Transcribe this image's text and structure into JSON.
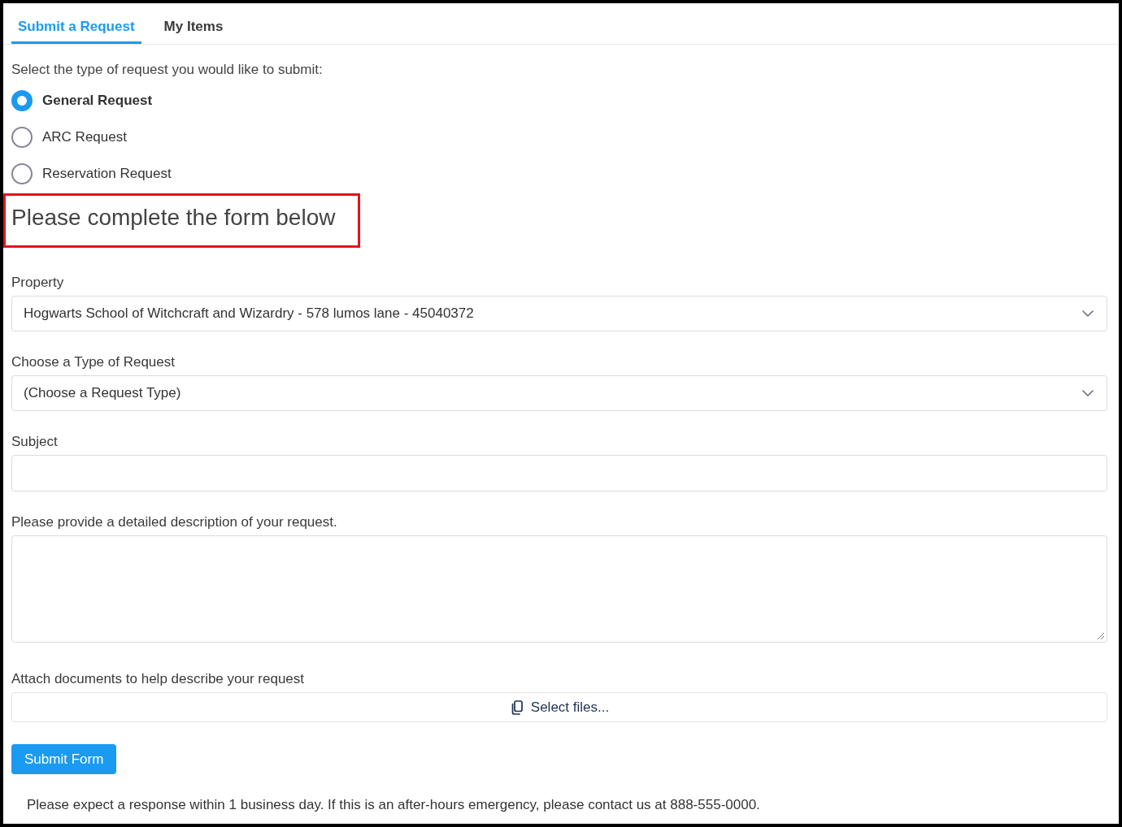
{
  "tabs": [
    {
      "label": "Submit a Request",
      "selected": true
    },
    {
      "label": "My Items",
      "selected": false
    }
  ],
  "request_type": {
    "prompt": "Select the type of request you would like to submit:",
    "options": [
      {
        "label": "General Request",
        "selected": true
      },
      {
        "label": "ARC Request",
        "selected": false
      },
      {
        "label": "Reservation Request",
        "selected": false
      }
    ]
  },
  "form": {
    "heading": "Please complete the form below",
    "heading_highlighted": true,
    "fields": [
      {
        "kind": "select",
        "label": "Property",
        "value": "Hogwarts School of Witchcraft and Wizardry - 578 lumos lane - 45040372"
      },
      {
        "kind": "select",
        "label": "Choose a Type of Request",
        "value": "(Choose a Request Type)"
      },
      {
        "kind": "text",
        "label": "Subject"
      },
      {
        "kind": "textarea",
        "label": "Please provide a detailed description of your request."
      },
      {
        "kind": "file",
        "label": "Attach documents to help describe your request",
        "button": "Select files..."
      }
    ],
    "submit_button": "Submit Form",
    "note": "Please expect a response within 1 business day. If this is an after-hours emergency, please contact us at 888-555-0000."
  }
}
